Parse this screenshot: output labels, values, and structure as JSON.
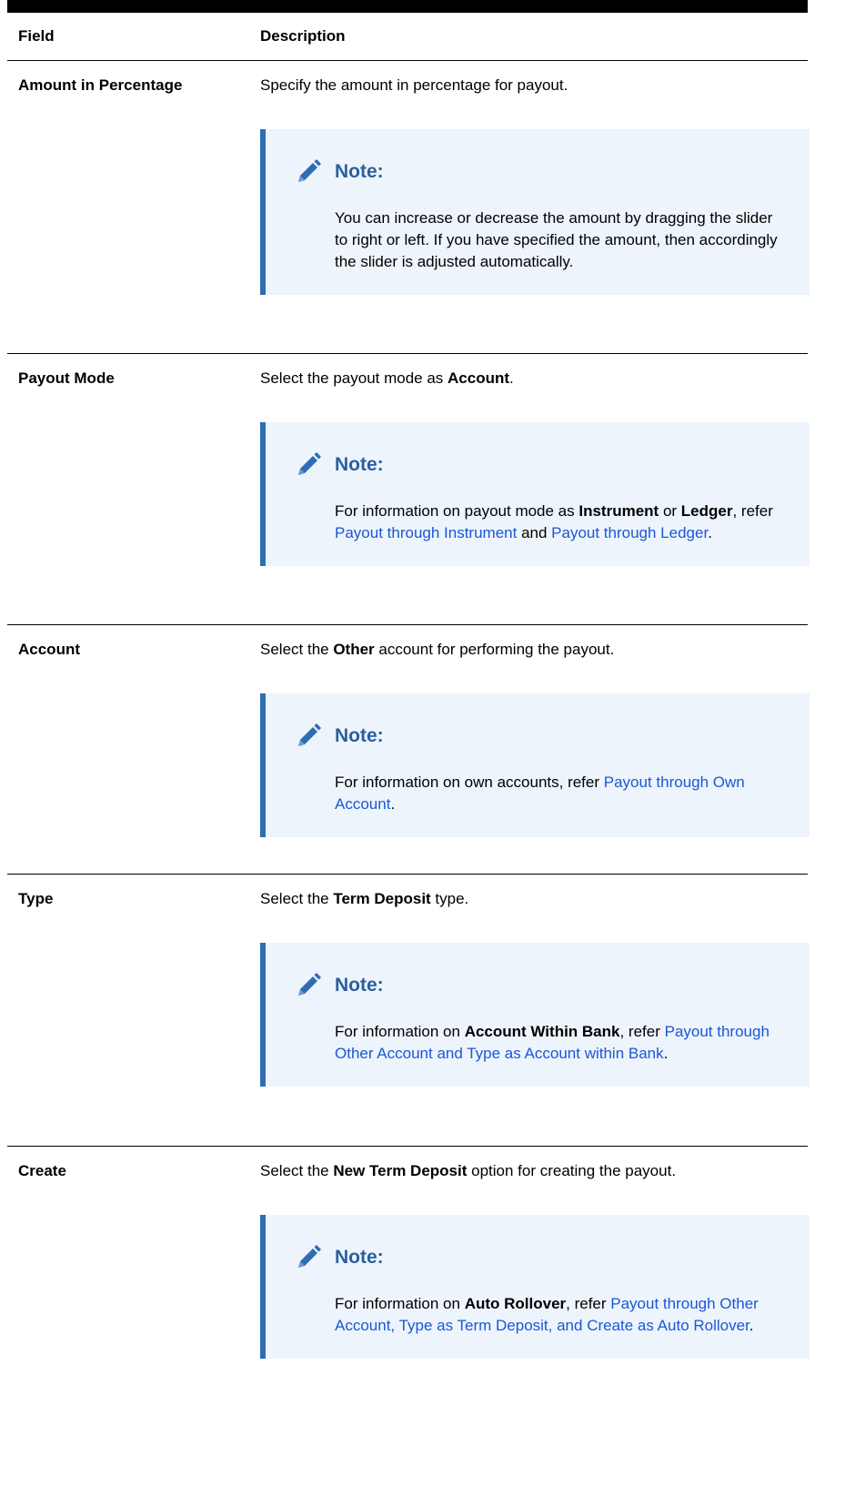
{
  "table": {
    "header_field": "Field",
    "header_description": "Description"
  },
  "note_label": "Note:",
  "rows": [
    {
      "field": "Amount in Percentage",
      "description": "Specify the amount in percentage for payout.",
      "note": "You can increase or decrease the amount by dragging the slider to right or left. If you have specified the amount, then accordingly the slider is adjusted automatically."
    },
    {
      "field": "Payout Mode",
      "desc_pre": "Select the payout mode as ",
      "desc_bold": "Account",
      "desc_post": ".",
      "note_pre": "For information on payout mode as ",
      "note_bold1": "Instrument",
      "note_mid1": " or ",
      "note_bold2": "Ledger",
      "note_mid2": ", refer ",
      "note_link1": "Payout through Instrument",
      "note_mid3": " and ",
      "note_link2": "Payout through Ledger",
      "note_post": "."
    },
    {
      "field": "Account",
      "desc_pre": "Select the ",
      "desc_bold": "Other",
      "desc_post": " account for performing the payout.",
      "note_pre": "For information on own accounts, refer ",
      "note_link": "Payout through Own Account",
      "note_post": "."
    },
    {
      "field": "Type",
      "desc_pre": "Select the ",
      "desc_bold": "Term Deposit",
      "desc_post": " type.",
      "note_pre": "For information on ",
      "note_bold": "Account Within Bank",
      "note_mid": ", refer ",
      "note_link": "Payout through Other Account and Type as Account within Bank",
      "note_post": "."
    },
    {
      "field": "Create",
      "desc_pre": "Select the ",
      "desc_bold": "New Term Deposit",
      "desc_post": " option for creating the payout.",
      "note_pre": "For information on ",
      "note_bold": "Auto Rollover",
      "note_mid": ", refer ",
      "note_link": "Payout through Other Account, Type as Term Deposit, and Create as Auto Rollover",
      "note_post": "."
    }
  ],
  "colors": {
    "note_background": "#eef4fb",
    "note_border": "#2e6db4",
    "note_title": "#2b5f9e",
    "link": "#1a57d6"
  }
}
